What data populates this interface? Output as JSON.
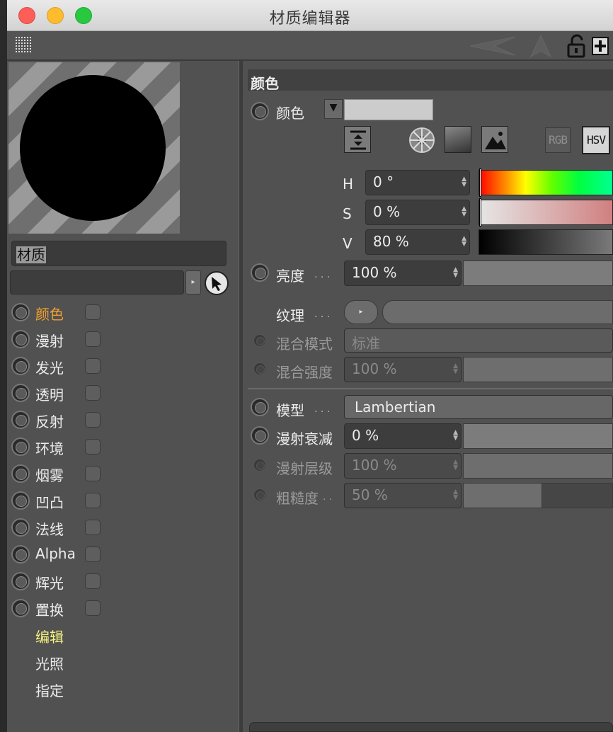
{
  "window": {
    "title": "材质编辑器"
  },
  "colors": {
    "accent_orange": "#f0a030",
    "accent_yellow": "#f4f080",
    "panel": "#515151"
  },
  "preview": {
    "name_value": "材质"
  },
  "channels": [
    {
      "label": "颜色"
    },
    {
      "label": "漫射"
    },
    {
      "label": "发光"
    },
    {
      "label": "透明"
    },
    {
      "label": "反射"
    },
    {
      "label": "环境"
    },
    {
      "label": "烟雾"
    },
    {
      "label": "凹凸"
    },
    {
      "label": "法线"
    },
    {
      "label": "Alpha"
    },
    {
      "label": "辉光"
    },
    {
      "label": "置换"
    }
  ],
  "extra_items": [
    {
      "label": "编辑"
    },
    {
      "label": "光照"
    },
    {
      "label": "指定"
    }
  ],
  "section": {
    "title": "颜色"
  },
  "color_row": {
    "label": "颜色"
  },
  "mode_buttons": {
    "rgb": "RGB",
    "hsv": "HSV"
  },
  "hsv": {
    "h_label": "H",
    "h_value": "0 °",
    "s_label": "S",
    "s_value": "0 %",
    "v_label": "V",
    "v_value": "80 %"
  },
  "brightness": {
    "label": "亮度",
    "value": "100 %"
  },
  "texture": {
    "label": "纹理"
  },
  "blend_mode": {
    "label": "混合模式",
    "value": "标准"
  },
  "blend_strength": {
    "label": "混合强度",
    "value": "100 %"
  },
  "model": {
    "label": "模型",
    "value": "Lambertian"
  },
  "diffuse_falloff": {
    "label": "漫射衰减",
    "value": "0 %"
  },
  "diffuse_level": {
    "label": "漫射层级",
    "value": "100 %"
  },
  "roughness": {
    "label": "粗糙度",
    "value": "50 %"
  },
  "dots": ". . ."
}
